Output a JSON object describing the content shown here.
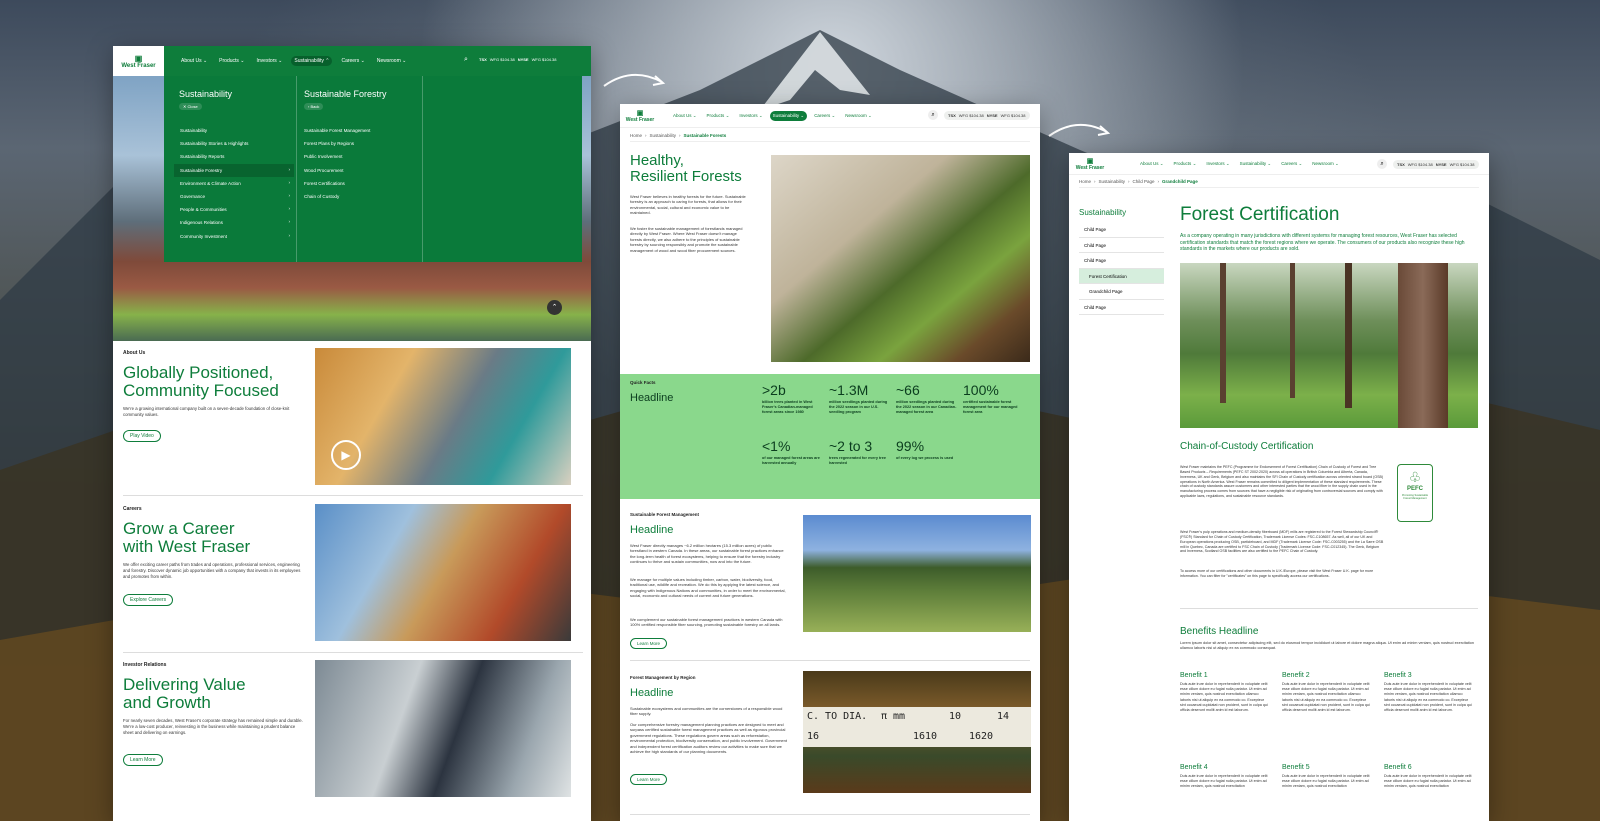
{
  "colors": {
    "brand": "#0e7d3b",
    "menu": "#0a7a3a",
    "facts": "#8ad88c"
  },
  "logo": "West Fraser",
  "nav": {
    "about": "About Us",
    "products": "Products",
    "investors": "Investors",
    "sustainability": "Sustainability",
    "careers": "Careers",
    "newsroom": "Newsroom"
  },
  "ticker": {
    "tsx": "TSX",
    "tsx_val": "WFG $104.38",
    "nyse": "NYSE",
    "nyse_val": "WFG $104.38"
  },
  "card1": {
    "menu": {
      "col1_title": "Sustainability",
      "close": "Close",
      "col1_items": [
        "Sustainability",
        "Sustainability Stories & Highlights",
        "Sustainability Reports",
        "Sustainable Forestry",
        "Environment & Climate Action",
        "Governance",
        "People & Communities",
        "Indigenous Relations",
        "Community Investment"
      ],
      "col2_title": "Sustainable Forestry",
      "back": "Back",
      "col2_items": [
        "Sustainable Forest Management",
        "Forest Plans by Regions",
        "Public Involvement",
        "Wood Procurement",
        "Forest Certifications",
        "Chain of Custody"
      ]
    },
    "s1": {
      "eyebrow": "About Us",
      "title1": "Globally Positioned,",
      "title2": "Community Focused",
      "body": "We're a growing international company built on a seven-decade foundation of close-knit community values.",
      "cta": "Play Video"
    },
    "s2": {
      "eyebrow": "Careers",
      "title1": "Grow a Career",
      "title2": "with West Fraser",
      "body": "We offer exciting career paths from trades and operations, professional services, engineering and forestry. Discover dynamic job opportunities with a company that invests in its employees and promotes from within.",
      "cta": "Explore Careers"
    },
    "s3": {
      "eyebrow": "Investor Relations",
      "title1": "Delivering Value",
      "title2": "and Growth",
      "body": "For nearly seven decades, West Fraser's corporate strategy has remained simple and durable. We're a low-cost producer, reinvesting in the business while maintaining a prudent balance sheet and delivering on earnings.",
      "cta": "Learn More"
    }
  },
  "card2": {
    "crumbs": [
      "Home",
      "Sustainability",
      "Sustainable Forests"
    ],
    "hero_title1": "Healthy,",
    "hero_title2": "Resilient Forests",
    "hero_p1": "West Fraser believes in healthy forests for the future. Sustainable forestry is an approach to caring for forests, that allows for their environmental, social, cultural and economic value to be maintained.",
    "hero_p2": "We foster the sustainable management of forestlands managed directly by West Fraser. Where West Fraser doesn't manage forests directly, we also adhere to the principles of sustainable forestry by sourcing responsibly and promote the sustainable management of wood and wood fiber procurement sources.",
    "facts_eyebrow": "Quick Facts",
    "facts_title": "Headline",
    "facts": [
      {
        "num": ">2b",
        "desc": "billion trees planted in West Fraser's Canadian-managed forest areas since 1980"
      },
      {
        "num": "~1.3M",
        "desc": "million seedlings planted during the 2022 season in our U.S. seedling program"
      },
      {
        "num": "~66",
        "desc": "million seedlings planted during the 2022 season in our Canadian-managed forest area"
      },
      {
        "num": "100%",
        "desc": "certified sustainable forest management for our managed forest area"
      },
      {
        "num": "<1%",
        "desc": "of our managed forest areas are harvested annually"
      },
      {
        "num": "~2 to 3",
        "desc": "trees regenerated for every tree harvested"
      },
      {
        "num": "99%",
        "desc": "of every log we process is used"
      }
    ],
    "sfm": {
      "eyebrow": "Sustainable Forest Management",
      "title": "Headline",
      "p1": "West Fraser directly manages ~6.2 million hectares (15.3 million acres) of public forestland in western Canada. In these areas, our sustainable forest practices enhance the long-term health of forest ecosystems, helping to ensure that the forestry industry continues to thrive and sustain communities, now and into the future.",
      "p2": "We manage for multiple values including timber, carbon, water, biodiversity, food, traditional use, wildlife and recreation. We do this by applying the latest science, and engaging with Indigenous Nations and communities, in order to meet the environmental, social, economic and cultural needs of current and future generations.",
      "p3": "We complement our sustainable forest management practices in western Canada with 100% certified responsible fiber sourcing, promoting sustainable forestry on all lands.",
      "cta": "Learn More"
    },
    "fmr": {
      "eyebrow": "Forest Management by Region",
      "title": "Headline",
      "p1": "Sustainable ecosystems and communities are the cornerstones of a responsible wood fiber supply.",
      "p2": "Our comprehensive forestry management planning practices are designed to meet and surpass certified sustainable forest management practices as well as rigorous provincial government regulations. These regulations govern areas such as reforestation, environmental protection, biodiversity conservation, and public involvement. Government and independent forest certification auditors review our activities to make sure that we achieve the high standards of our planning documents.",
      "cta": "Learn More"
    },
    "ruler": [
      "C. TO DIA.",
      "π mm",
      "10",
      "14",
      "16",
      "1610",
      "1620"
    ]
  },
  "card3": {
    "crumbs": [
      "Home",
      "Sustainability",
      "Child Page",
      "Grandchild Page"
    ],
    "side_title": "Sustainability",
    "side_items": [
      "Child Page",
      "Child Page",
      "Child Page",
      "Forest Certification",
      "Grandchild Page",
      "Child Page"
    ],
    "title": "Forest Certification",
    "lead": "As a company operating in many jurisdictions with different systems for managing forest resources, West Fraser has selected certification standards that match the forest regions where we operate. The consumers of our products also recognize these high standards in the markets where our products are sold.",
    "coc_title": "Chain-of-Custody Certification",
    "coc_p1": "West Fraser maintains the PEFC (Programme for Endorsement of Forest Certification) Chain of Custody of Forest and Tree Based Products – Requirements (PEFC ST 2002:2020) across all operations in British Columbia and Alberta, Canada, Inverness, UK and Genk, Belgium and also maintains the SFI Chain of Custody certification across oriented strand board (OSB) operations in North America. West Fraser remains committed to diligent implementation of these standard requirements. These chain of custody standards assure customers and other interested parties that the wood fiber in the supply chain used in the manufacturing process comes from sources that have a negligible risk of originating from controversial sources and comply with applicable laws, regulations, and sustainable resource standards.",
    "coc_p2": "West Fraser's pulp operations and medium-density fiberboard (MDF) mills are registered to the Forest Stewardship Council® (FSC®) Standard for Chain of Custody Certification, Trademark License Codes: FSC-C108657. As well, all of our UK and European operations producing OSB, particleboard, and MDF (Trademark License Code: FSC-C003255) and the La Sarre OSB mill in Quebec, Canada are certified to FSC Chain of Custody (Trademark License Code: FSC-C012345). The Genk, Belgium and Inverness, Scotland OSB facilities are also certified to the PEFC Chain of Custody.",
    "coc_p3": "To access more of our certifications and other documents in U.K./Europe, please visit the West Fraser U.K. page for more information. You can filter for \"certificates\" on this page to specifically access our certifications.",
    "pefc": "PEFC",
    "pefc_sub": "Promoting Sustainable Forest Management",
    "benefits_title": "Benefits Headline",
    "benefits_lead": "Lorem ipsum dolor sit amet, consectetur adipiscing elit, sed do eiusmod tempor incididunt ut labore et dolore magna aliqua. Ut enim ad minim veniam, quis nostrud exercitation ullamco laboris nisi ut aliquip ex ea commodo consequat.",
    "benefits": [
      {
        "t": "Benefit 1",
        "d": "Duis aute irure dolor in reprehenderit in voluptate velit esse cillum dolore eu fugiat nulla pariatur. Ut enim ad minim veniam, quis nostrud exercitation ullamco laboris nisi ut aliquip ex ea commodo co. Excepteur sint occaecat cupidatat non proident, sunt in culpa qui officia deserunt mollit anim id est laborum."
      },
      {
        "t": "Benefit 2",
        "d": "Duis aute irure dolor in reprehenderit in voluptate velit esse cillum dolore eu fugiat nulla pariatur. Ut enim ad minim veniam, quis nostrud exercitation ullamco laboris nisi ut aliquip ex ea commodo co. Excepteur sint occaecat cupidatat non proident, sunt in culpa qui officia deserunt mollit anim id est laborum."
      },
      {
        "t": "Benefit 3",
        "d": "Duis aute irure dolor in reprehenderit in voluptate velit esse cillum dolore eu fugiat nulla pariatur. Ut enim ad minim veniam, quis nostrud exercitation ullamco laboris nisi ut aliquip ex ea commodo co. Excepteur sint occaecat cupidatat non proident, sunt in culpa qui officia deserunt mollit anim id est laborum."
      },
      {
        "t": "Benefit 4",
        "d": "Duis aute irure dolor in reprehenderit in voluptate velit esse cillum dolore eu fugiat nulla pariatur. Ut enim ad minim veniam, quis nostrud exercitation"
      },
      {
        "t": "Benefit 5",
        "d": "Duis aute irure dolor in reprehenderit in voluptate velit esse cillum dolore eu fugiat nulla pariatur. Ut enim ad minim veniam, quis nostrud exercitation"
      },
      {
        "t": "Benefit 6",
        "d": "Duis aute irure dolor in reprehenderit in voluptate velit esse cillum dolore eu fugiat nulla pariatur. Ut enim ad minim veniam, quis nostrud exercitation"
      }
    ]
  }
}
